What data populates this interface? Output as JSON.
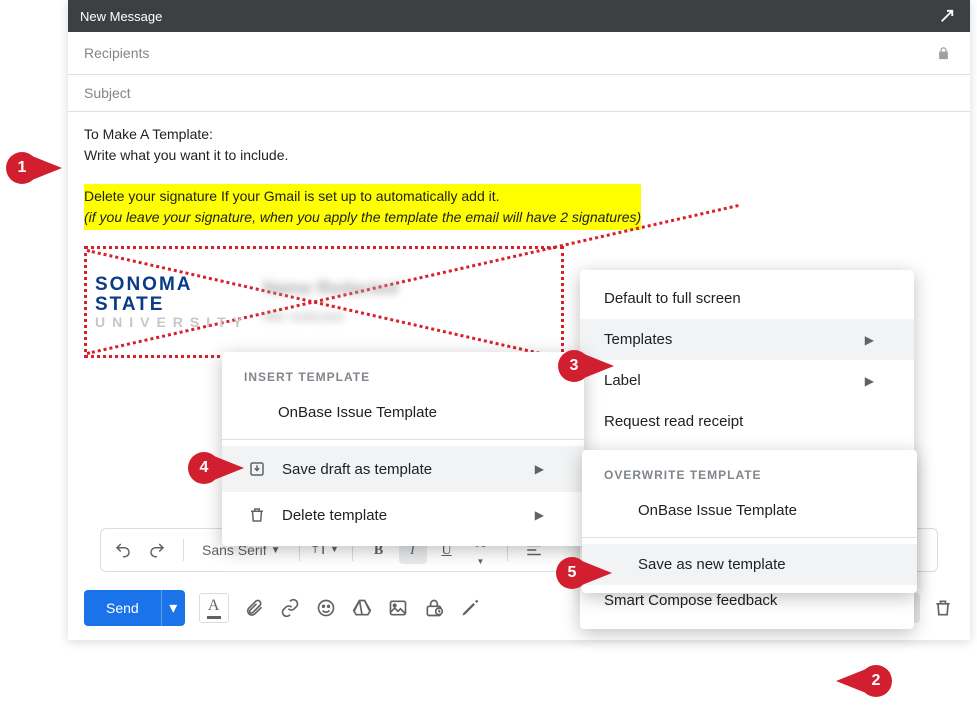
{
  "titlebar": {
    "title": "New Message"
  },
  "fields": {
    "recipients_placeholder": "Recipients",
    "subject_placeholder": "Subject"
  },
  "body": {
    "line1": "To Make A Template:",
    "line2": "Write what you want it to include.",
    "highlight1": "Delete your signature If your Gmail is set up to automatically add it.",
    "highlight2": "(if you leave your signature, when you apply the template the email will have 2 signatures)",
    "logo_line1": "SONOMA",
    "logo_line2": "STATE",
    "logo_line3": "UNIVERSITY"
  },
  "format_bar": {
    "font": "Sans Serif"
  },
  "send_label": "Send",
  "main_menu": {
    "default_full": "Default to full screen",
    "templates": "Templates",
    "label": "Label",
    "read_receipt": "Request read receipt",
    "smart_compose": "Smart Compose feedback"
  },
  "templates_menu": {
    "header_insert": "INSERT TEMPLATE",
    "item_onbase": "OnBase Issue Template",
    "save_draft": "Save draft as template",
    "delete_template": "Delete template"
  },
  "save_menu": {
    "header_overwrite": "OVERWRITE TEMPLATE",
    "item_onbase": "OnBase Issue Template",
    "save_new": "Save as new template"
  },
  "callouts": {
    "c1": "1",
    "c2": "2",
    "c3": "3",
    "c4": "4",
    "c5": "5"
  }
}
